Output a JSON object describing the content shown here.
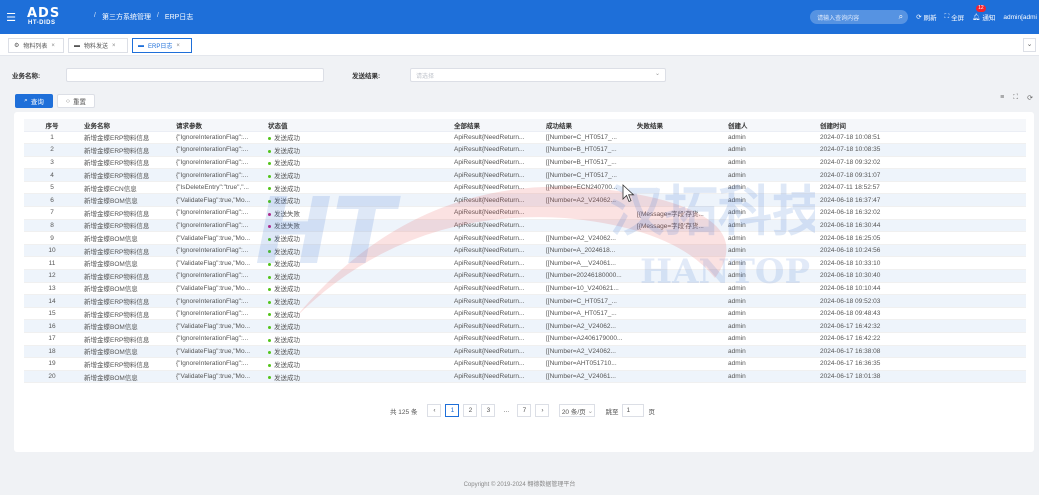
{
  "topbar": {
    "menu_icon": "hamburger-icon",
    "logo_big": "ADS",
    "logo_small": "HT-DIDS",
    "breadcrumb": [
      "第三方系统管理",
      "ERP日志"
    ],
    "search_placeholder": "请输入查询内容",
    "refresh_label": "刷新",
    "fullscreen_label": "全屏",
    "notify_label": "通知",
    "notify_count": "12",
    "user_label": "admin[admi",
    "color": "#1e6fd9"
  },
  "tabs": [
    {
      "label": "物料列表",
      "icon": "gear-icon"
    },
    {
      "label": "物料发送",
      "icon": "monitor-icon"
    },
    {
      "label": "ERP日志",
      "icon": "monitor-icon",
      "active": true
    }
  ],
  "filters": {
    "business_label": "业务名称:",
    "business_value": "",
    "send_result_label": "发送结果:",
    "send_result_placeholder": "请选择"
  },
  "buttons": {
    "search": "查询",
    "reset": "重置"
  },
  "table": {
    "columns": [
      "序号",
      "业务名称",
      "请求参数",
      "状态值",
      "全部结果",
      "成功结果",
      "失败结果",
      "创建人",
      "创建时间"
    ],
    "rows": [
      [
        "1",
        "新增金蝶ERP物料信息",
        "{\"IgnoreInterationFlag\":...",
        "发送成功",
        "ApiResult{NeedReturn...",
        "[[Number=C_HT0517_...",
        "",
        "admin",
        "2024-07-18 10:08:51"
      ],
      [
        "2",
        "新增金蝶ERP物料信息",
        "{\"IgnoreInterationFlag\":...",
        "发送成功",
        "ApiResult{NeedReturn...",
        "[[Number=B_HT0517_...",
        "",
        "admin",
        "2024-07-18 10:08:35"
      ],
      [
        "3",
        "新增金蝶ERP物料信息",
        "{\"IgnoreInterationFlag\":...",
        "发送成功",
        "ApiResult{NeedReturn...",
        "[[Number=B_HT0517_...",
        "",
        "admin",
        "2024-07-18 09:32:02"
      ],
      [
        "4",
        "新增金蝶ERP物料信息",
        "{\"IgnoreInterationFlag\":...",
        "发送成功",
        "ApiResult{NeedReturn...",
        "[[Number=C_HT0517_...",
        "",
        "admin",
        "2024-07-18 09:31:07"
      ],
      [
        "5",
        "新增金蝶ECN信息",
        "{\"IsDeleteEntry\":\"true\",\"...",
        "发送成功",
        "ApiResult{NeedReturn...",
        "[[Number=ECN240700...",
        "",
        "admin",
        "2024-07-11 18:52:57"
      ],
      [
        "6",
        "新增金蝶BOM信息",
        "{\"ValidateFlag\":true,\"Mo...",
        "发送成功",
        "ApiResult{NeedReturn...",
        "[[Number=A2_V24062...",
        "",
        "admin",
        "2024-06-18 16:37:47"
      ],
      [
        "7",
        "新增金蝶ERP物料信息",
        "{\"IgnoreInterationFlag\":...",
        "发送失败",
        "ApiResult{NeedReturn...",
        "",
        "[{Message=字段'存货...",
        "admin",
        "2024-06-18 16:32:02"
      ],
      [
        "8",
        "新增金蝶ERP物料信息",
        "{\"IgnoreInterationFlag\":...",
        "发送失败",
        "ApiResult{NeedReturn...",
        "",
        "[{Message=字段'存货...",
        "admin",
        "2024-06-18 16:30:44"
      ],
      [
        "9",
        "新增金蝶BOM信息",
        "{\"ValidateFlag\":true,\"Mo...",
        "发送成功",
        "ApiResult{NeedReturn...",
        "[[Number=A2_V24062...",
        "",
        "admin",
        "2024-06-18 16:25:05"
      ],
      [
        "10",
        "新增金蝶ERP物料信息",
        "{\"IgnoreInterationFlag\":...",
        "发送成功",
        "ApiResult{NeedReturn...",
        "[[Number=A_2024618...",
        "",
        "admin",
        "2024-06-18 10:24:56"
      ],
      [
        "11",
        "新增金蝶BOM信息",
        "{\"ValidateFlag\":true,\"Mo...",
        "发送成功",
        "ApiResult{NeedReturn...",
        "[[Number=A__V24061...",
        "",
        "admin",
        "2024-06-18 10:33:10"
      ],
      [
        "12",
        "新增金蝶ERP物料信息",
        "{\"IgnoreInterationFlag\":...",
        "发送成功",
        "ApiResult{NeedReturn...",
        "[[Number=20246180000...",
        "",
        "admin",
        "2024-06-18 10:30:40"
      ],
      [
        "13",
        "新增金蝶BOM信息",
        "{\"ValidateFlag\":true,\"Mo...",
        "发送成功",
        "ApiResult{NeedReturn...",
        "[[Number=10_V240621...",
        "",
        "admin",
        "2024-06-18 10:10:44"
      ],
      [
        "14",
        "新增金蝶ERP物料信息",
        "{\"IgnoreInterationFlag\":...",
        "发送成功",
        "ApiResult{NeedReturn...",
        "[[Number=C_HT0517_...",
        "",
        "admin",
        "2024-06-18 09:52:03"
      ],
      [
        "15",
        "新增金蝶ERP物料信息",
        "{\"IgnoreInterationFlag\":...",
        "发送成功",
        "ApiResult{NeedReturn...",
        "[[Number=A_HT0517_...",
        "",
        "admin",
        "2024-06-18 09:48:43"
      ],
      [
        "16",
        "新增金蝶BOM信息",
        "{\"ValidateFlag\":true,\"Mo...",
        "发送成功",
        "ApiResult{NeedReturn...",
        "[[Number=A2_V24062...",
        "",
        "admin",
        "2024-06-17 16:42:32"
      ],
      [
        "17",
        "新增金蝶ERP物料信息",
        "{\"IgnoreInterationFlag\":...",
        "发送成功",
        "ApiResult{NeedReturn...",
        "[[Number=A2406179000...",
        "",
        "admin",
        "2024-06-17 16:42:22"
      ],
      [
        "18",
        "新增金蝶BOM信息",
        "{\"ValidateFlag\":true,\"Mo...",
        "发送成功",
        "ApiResult{NeedReturn...",
        "[[Number=A2_V24062...",
        "",
        "admin",
        "2024-06-17 16:38:08"
      ],
      [
        "19",
        "新增金蝶ERP物料信息",
        "{\"IgnoreInterationFlag\":...",
        "发送成功",
        "ApiResult{NeedReturn...",
        "[[Number=AHT051710...",
        "",
        "admin",
        "2024-06-17 16:36:35"
      ],
      [
        "20",
        "新增金蝶BOM信息",
        "{\"ValidateFlag\":true,\"Mo...",
        "发送成功",
        "ApiResult{NeedReturn...",
        "[[Number=A2_V24061...",
        "",
        "admin",
        "2024-06-17 18:01:38"
      ]
    ],
    "status_colors": {
      "发送成功": "#52c41a",
      "发送失败": "#c41d7f"
    }
  },
  "pagination": {
    "total": "共 125 条",
    "pages": [
      "1",
      "2",
      "3",
      "...",
      "7"
    ],
    "current": "1",
    "page_size": "20 条/页",
    "jump_label": "跳至",
    "jump_value": "1",
    "page_unit": "页"
  },
  "footer": "Copyright © 2019-2024 翱德数据管理平台",
  "watermark": {
    "cn": "汉拓科技",
    "en": "HANTOP",
    "mark": "HT"
  }
}
